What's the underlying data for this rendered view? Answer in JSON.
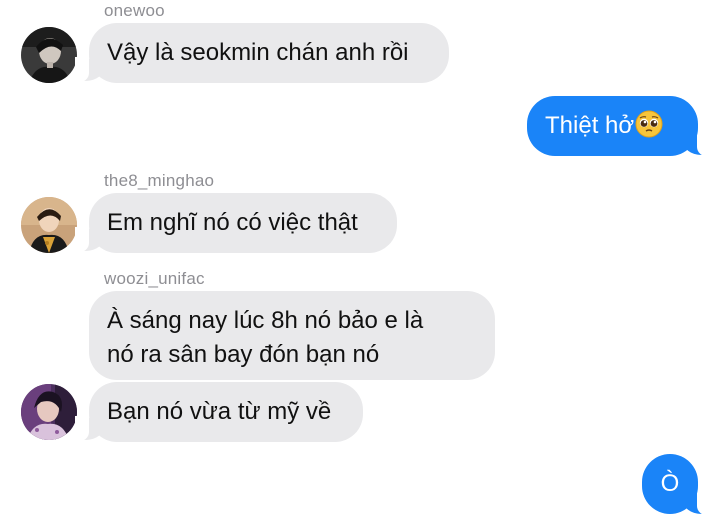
{
  "conversation": {
    "messages": [
      {
        "sender": "onewoo",
        "direction": "incoming",
        "text": "Vậy là seokmin chán anh rồi",
        "avatar_icon": "profile-photo-icon"
      },
      {
        "sender": "",
        "direction": "outgoing",
        "text": "Thiệt hở",
        "emoji_icon": "pleading-face-emoji-icon"
      },
      {
        "sender": "the8_minghao",
        "direction": "incoming",
        "text": "Em nghĩ nó có việc thật",
        "avatar_icon": "profile-photo-icon"
      },
      {
        "sender": "woozi_unifac",
        "direction": "incoming",
        "text_line1": "À sáng nay lúc 8h nó bảo e là",
        "text_line2": "nó ra sân bay đón bạn nó"
      },
      {
        "sender": "",
        "direction": "incoming",
        "text": "Bạn nó vừa từ mỹ về",
        "avatar_icon": "profile-photo-icon"
      },
      {
        "sender": "",
        "direction": "outgoing",
        "text": "Ò"
      }
    ]
  },
  "colors": {
    "incoming_bubble": "#e9e9eb",
    "outgoing_bubble": "#1a84f8",
    "sender_name": "#8e8e93"
  }
}
